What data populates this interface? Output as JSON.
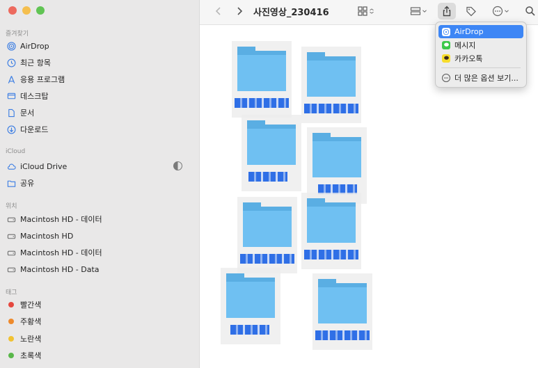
{
  "window": {
    "title": "사진영상_230416"
  },
  "sidebar": {
    "sections": [
      {
        "title": "즐겨찾기",
        "items": [
          {
            "label": "AirDrop",
            "icon": "airdrop-icon"
          },
          {
            "label": "최근 항목",
            "icon": "clock-icon"
          },
          {
            "label": "응용 프로그램",
            "icon": "applications-icon"
          },
          {
            "label": "데스크탑",
            "icon": "desktop-icon"
          },
          {
            "label": "문서",
            "icon": "document-icon"
          },
          {
            "label": "다운로드",
            "icon": "download-icon"
          }
        ]
      },
      {
        "title": "iCloud",
        "items": [
          {
            "label": "iCloud Drive",
            "icon": "cloud-icon"
          },
          {
            "label": "공유",
            "icon": "shared-folder-icon"
          }
        ]
      },
      {
        "title": "위치",
        "items": [
          {
            "label": "Macintosh HD - 데이터",
            "icon": "disk-icon"
          },
          {
            "label": "Macintosh HD",
            "icon": "disk-icon"
          },
          {
            "label": "Macintosh HD - 데이터",
            "icon": "disk-icon"
          },
          {
            "label": "Macintosh HD - Data",
            "icon": "disk-icon"
          }
        ]
      },
      {
        "title": "태그",
        "items": [
          {
            "label": "빨간색",
            "color": "#e5483f"
          },
          {
            "label": "주황색",
            "color": "#ee8a2c"
          },
          {
            "label": "노란색",
            "color": "#f1c232"
          },
          {
            "label": "초록색",
            "color": "#59b74a"
          }
        ]
      }
    ]
  },
  "share_menu": {
    "items": [
      {
        "label": "AirDrop",
        "icon": "airdrop-icon",
        "selected": true
      },
      {
        "label": "메시지",
        "icon": "messages-icon"
      },
      {
        "label": "카카오톡",
        "icon": "kakaotalk-icon"
      }
    ],
    "more": "더 많은 옵션 보기..."
  },
  "folders_count": 8
}
